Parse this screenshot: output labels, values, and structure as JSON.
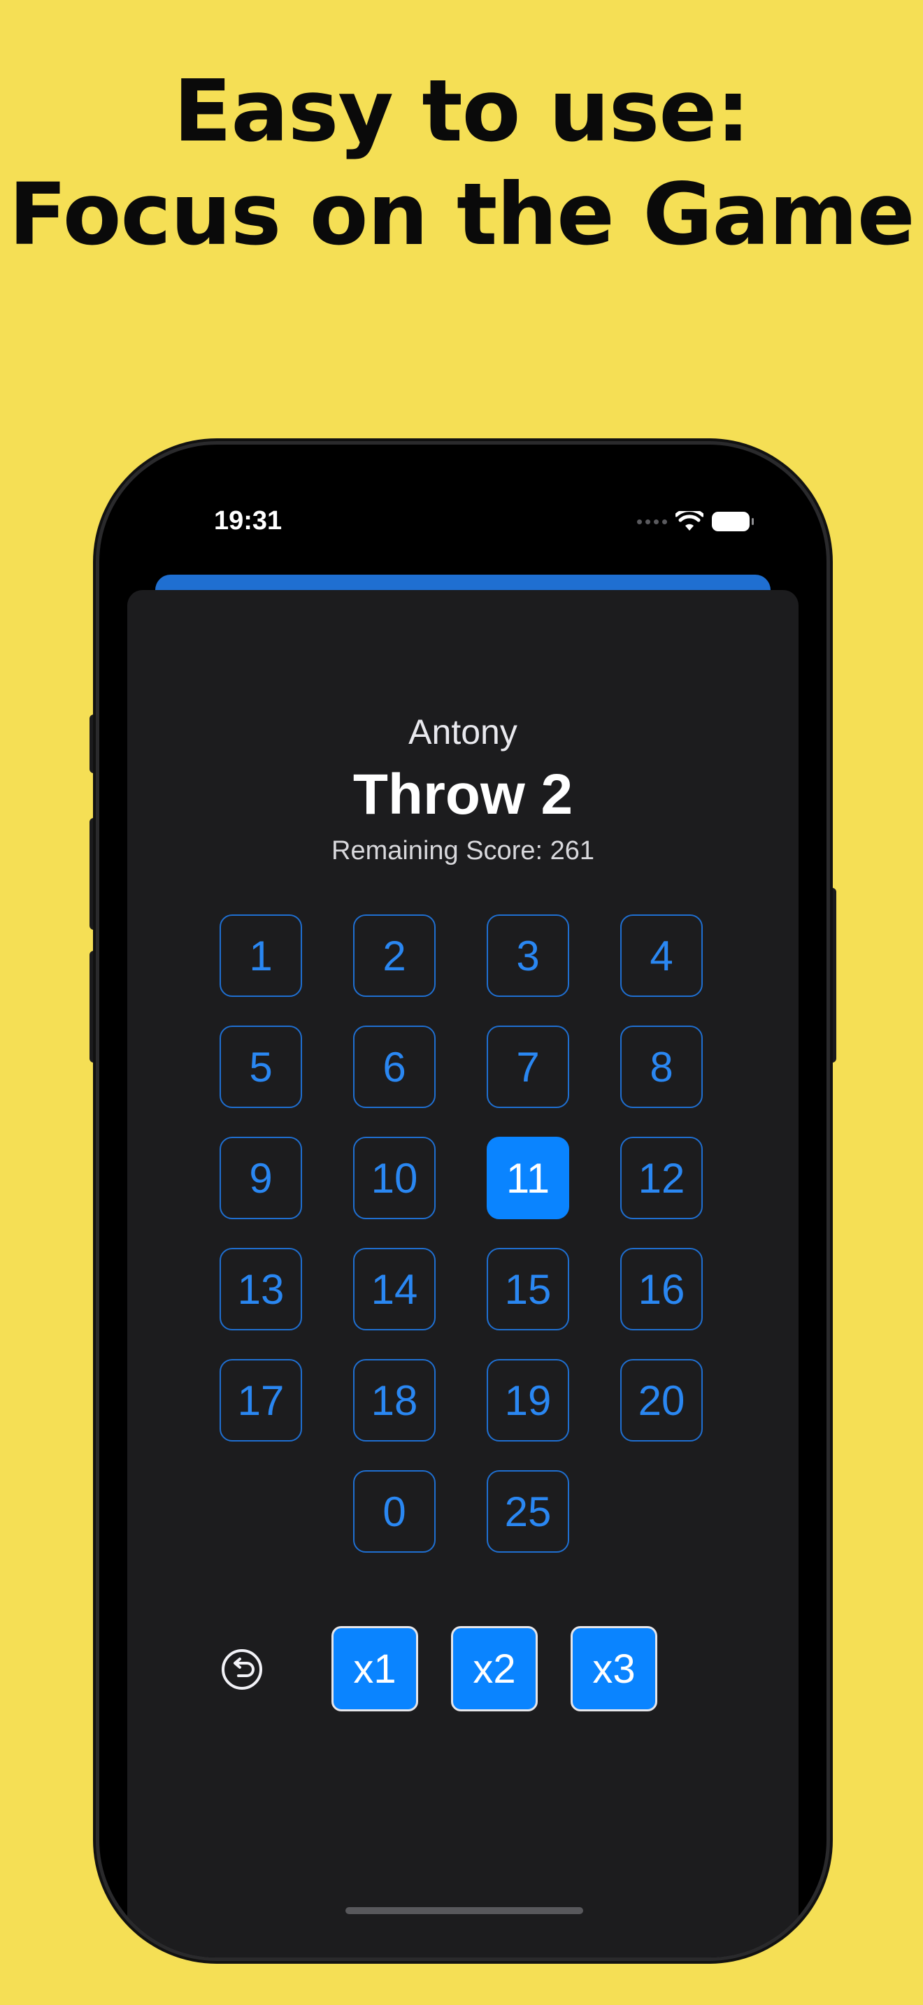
{
  "headline": {
    "line1": "Easy to use:",
    "line2": "Focus on the Game"
  },
  "colors": {
    "background": "#f5df55",
    "accent": "#0a84ff",
    "sheet": "#1c1c1e"
  },
  "status_bar": {
    "time": "19:31",
    "icons": [
      "signal-dots-icon",
      "wifi-icon",
      "battery-icon"
    ]
  },
  "game": {
    "player": "Antony",
    "throw_title": "Throw 2",
    "remaining_score": "Remaining Score: 261",
    "number_buttons": [
      {
        "label": "1"
      },
      {
        "label": "2"
      },
      {
        "label": "3"
      },
      {
        "label": "4"
      },
      {
        "label": "5"
      },
      {
        "label": "6"
      },
      {
        "label": "7"
      },
      {
        "label": "8"
      },
      {
        "label": "9"
      },
      {
        "label": "10"
      },
      {
        "label": "11",
        "selected": true
      },
      {
        "label": "12"
      },
      {
        "label": "13"
      },
      {
        "label": "14"
      },
      {
        "label": "15"
      },
      {
        "label": "16"
      },
      {
        "label": "17"
      },
      {
        "label": "18"
      },
      {
        "label": "19"
      },
      {
        "label": "20"
      },
      {
        "label": "0"
      },
      {
        "label": "25"
      }
    ],
    "selected_number": "11",
    "multipliers": [
      {
        "label": "x1"
      },
      {
        "label": "x2"
      },
      {
        "label": "x3"
      }
    ],
    "undo_icon": "undo-icon"
  }
}
